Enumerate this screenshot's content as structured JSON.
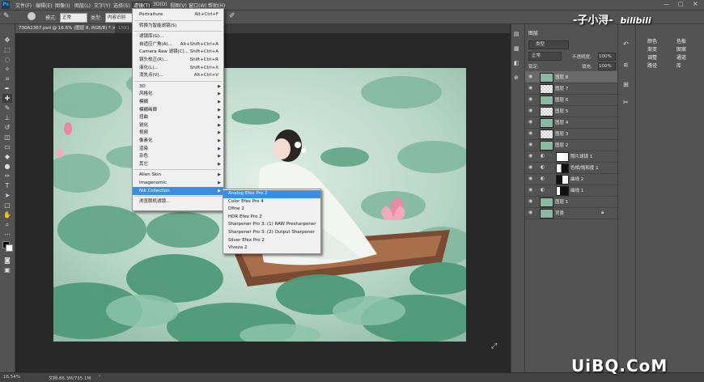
{
  "menubar": {
    "logo": "Ps",
    "items": [
      "文件(F)",
      "编辑(E)",
      "图像(I)",
      "图层(L)",
      "文字(Y)",
      "选择(S)",
      "滤镜(T)",
      "3D(D)",
      "视图(V)",
      "窗口(W)",
      "帮助(H)"
    ]
  },
  "optbar": {
    "mode_label": "模式:",
    "mode_value": "正常",
    "type_label": "类型:",
    "type_value": "内容识别",
    "extra": "1591"
  },
  "tabs": [
    {
      "label": "730A1367.psd @ 16.6% (图层 8, RGB/8) *",
      "close": "×"
    }
  ],
  "statusbar": {
    "zoom": "16.54%",
    "doc": "文档:86.3M/735.1M",
    "arrow": "›"
  },
  "filter_menu": {
    "items": [
      {
        "label": "Portraiture",
        "shortcut": "Alt+Ctrl+F"
      },
      {
        "sep": true
      },
      {
        "label": "转换为智能滤镜(S)",
        "shortcut": ""
      },
      {
        "sep": true
      },
      {
        "label": "滤镜库(G)...",
        "shortcut": ""
      },
      {
        "label": "自适应广角(A)...",
        "shortcut": "Alt+Shift+Ctrl+A"
      },
      {
        "label": "Camera Raw 滤镜(C)...",
        "shortcut": "Shift+Ctrl+A"
      },
      {
        "label": "镜头校正(R)...",
        "shortcut": "Shift+Ctrl+R"
      },
      {
        "label": "液化(L)...",
        "shortcut": "Shift+Ctrl+X"
      },
      {
        "label": "消失点(V)...",
        "shortcut": "Alt+Ctrl+V"
      },
      {
        "sep": true
      },
      {
        "label": "3D",
        "sub": true
      },
      {
        "label": "风格化",
        "sub": true
      },
      {
        "label": "模糊",
        "sub": true
      },
      {
        "label": "模糊画廊",
        "sub": true
      },
      {
        "label": "扭曲",
        "sub": true
      },
      {
        "label": "锐化",
        "sub": true
      },
      {
        "label": "视频",
        "sub": true
      },
      {
        "label": "像素化",
        "sub": true
      },
      {
        "label": "渲染",
        "sub": true
      },
      {
        "label": "杂色",
        "sub": true
      },
      {
        "label": "其它",
        "sub": true
      },
      {
        "sep": true
      },
      {
        "label": "Alien Skin",
        "sub": true
      },
      {
        "label": "Imagenomic",
        "sub": true
      },
      {
        "label": "Nik Collection",
        "sub": true,
        "hl": true
      },
      {
        "sep": true
      },
      {
        "label": "浏览联机滤镜...",
        "shortcut": ""
      }
    ]
  },
  "nik_menu": {
    "items": [
      {
        "label": "Analog Efex Pro 2",
        "hl": true
      },
      {
        "label": "Color Efex Pro 4"
      },
      {
        "label": "Dfine 2"
      },
      {
        "label": "HDR Efex Pro 2"
      },
      {
        "label": "Sharpener Pro 3: (1) RAW Presharpener"
      },
      {
        "label": "Sharpener Pro 3: (2) Output Sharpener"
      },
      {
        "label": "Silver Efex Pro 2"
      },
      {
        "label": "Viveza 2"
      }
    ]
  },
  "layers_panel": {
    "title": "图层",
    "kind_label": "类型",
    "blend_mode": "正常",
    "opacity_label": "不透明度:",
    "opacity_value": "100%",
    "lock_label": "锁定:",
    "fill_label": "填充:",
    "fill_value": "100%",
    "layers": [
      {
        "name": "图层 8",
        "selected": true,
        "kind": "pixel"
      },
      {
        "name": "图层 7",
        "kind": "trans"
      },
      {
        "name": "图层 6",
        "kind": "pixel"
      },
      {
        "name": "图层 5",
        "kind": "trans"
      },
      {
        "name": "图层 4",
        "kind": "pixel"
      },
      {
        "name": "图层 3",
        "kind": "trans"
      },
      {
        "name": "图层 2",
        "kind": "pixel"
      },
      {
        "name": "照片滤镜 1",
        "kind": "adj"
      },
      {
        "name": "色相/饱和度 1",
        "kind": "adj"
      },
      {
        "name": "曲线 2",
        "kind": "adj"
      },
      {
        "name": "曲线 1",
        "kind": "adj"
      },
      {
        "name": "图层 1",
        "kind": "pixel"
      },
      {
        "name": "背景",
        "kind": "pixel",
        "locked": true
      }
    ],
    "bottom_icons": [
      "fx"
    ]
  },
  "side_strip": {
    "icons": [
      "history-icon",
      "adjust-icon",
      "properties-icon",
      "brush-icon"
    ]
  },
  "prop_panel": {
    "items": [
      "颜色",
      "色板",
      "渐变",
      "图案",
      "调整",
      "通道",
      "路径",
      "库"
    ]
  },
  "watermarks": {
    "top": "-子小浔-",
    "bili": "bilibili",
    "bottom": "UiBQ.CoM"
  },
  "colors": {
    "menu_highlight": "#3a8ee6",
    "ps_bg": "#535353"
  }
}
